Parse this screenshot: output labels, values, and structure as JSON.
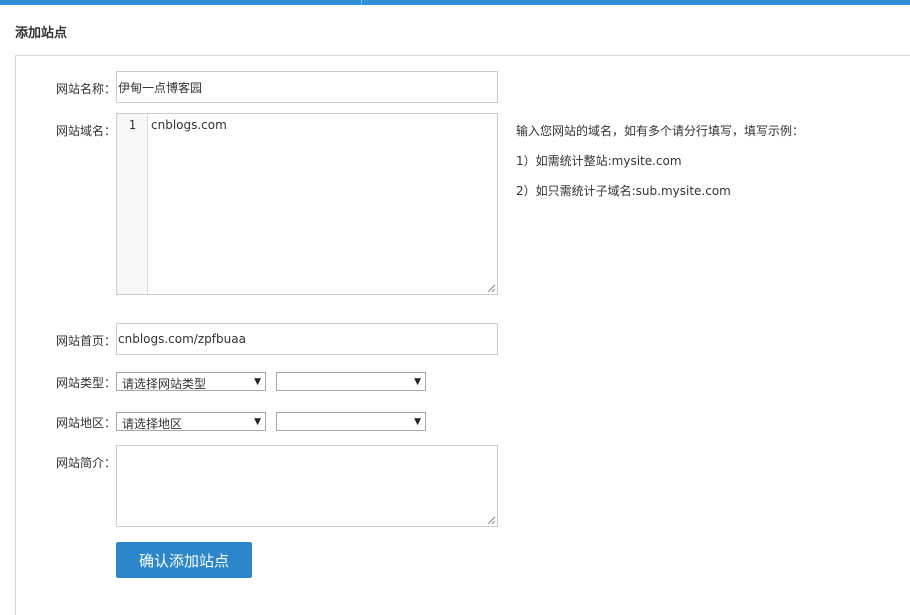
{
  "page": {
    "title": "添加站点"
  },
  "form": {
    "site_name": {
      "label": "网站名称：",
      "value": "伊甸一点博客园"
    },
    "domain": {
      "label": "网站域名：",
      "line_number": "1",
      "value": "cnblogs.com"
    },
    "homepage": {
      "label": "网站首页：",
      "value": "cnblogs.com/zpfbuaa"
    },
    "site_type": {
      "label": "网站类型：",
      "primary_selected": "请选择网站类型",
      "secondary_selected": ""
    },
    "region": {
      "label": "网站地区：",
      "primary_selected": "请选择地区",
      "secondary_selected": ""
    },
    "intro": {
      "label": "网站简介：",
      "value": ""
    },
    "submit_label": "确认添加站点"
  },
  "hints": {
    "line1": "输入您网站的域名，如有多个请分行填写，填写示例：",
    "line2": "1）如需统计整站:mysite.com",
    "line3": "2）如只需统计子域名:sub.mysite.com"
  },
  "colors": {
    "accent": "#2f8fd6",
    "button": "#2b87c9"
  }
}
